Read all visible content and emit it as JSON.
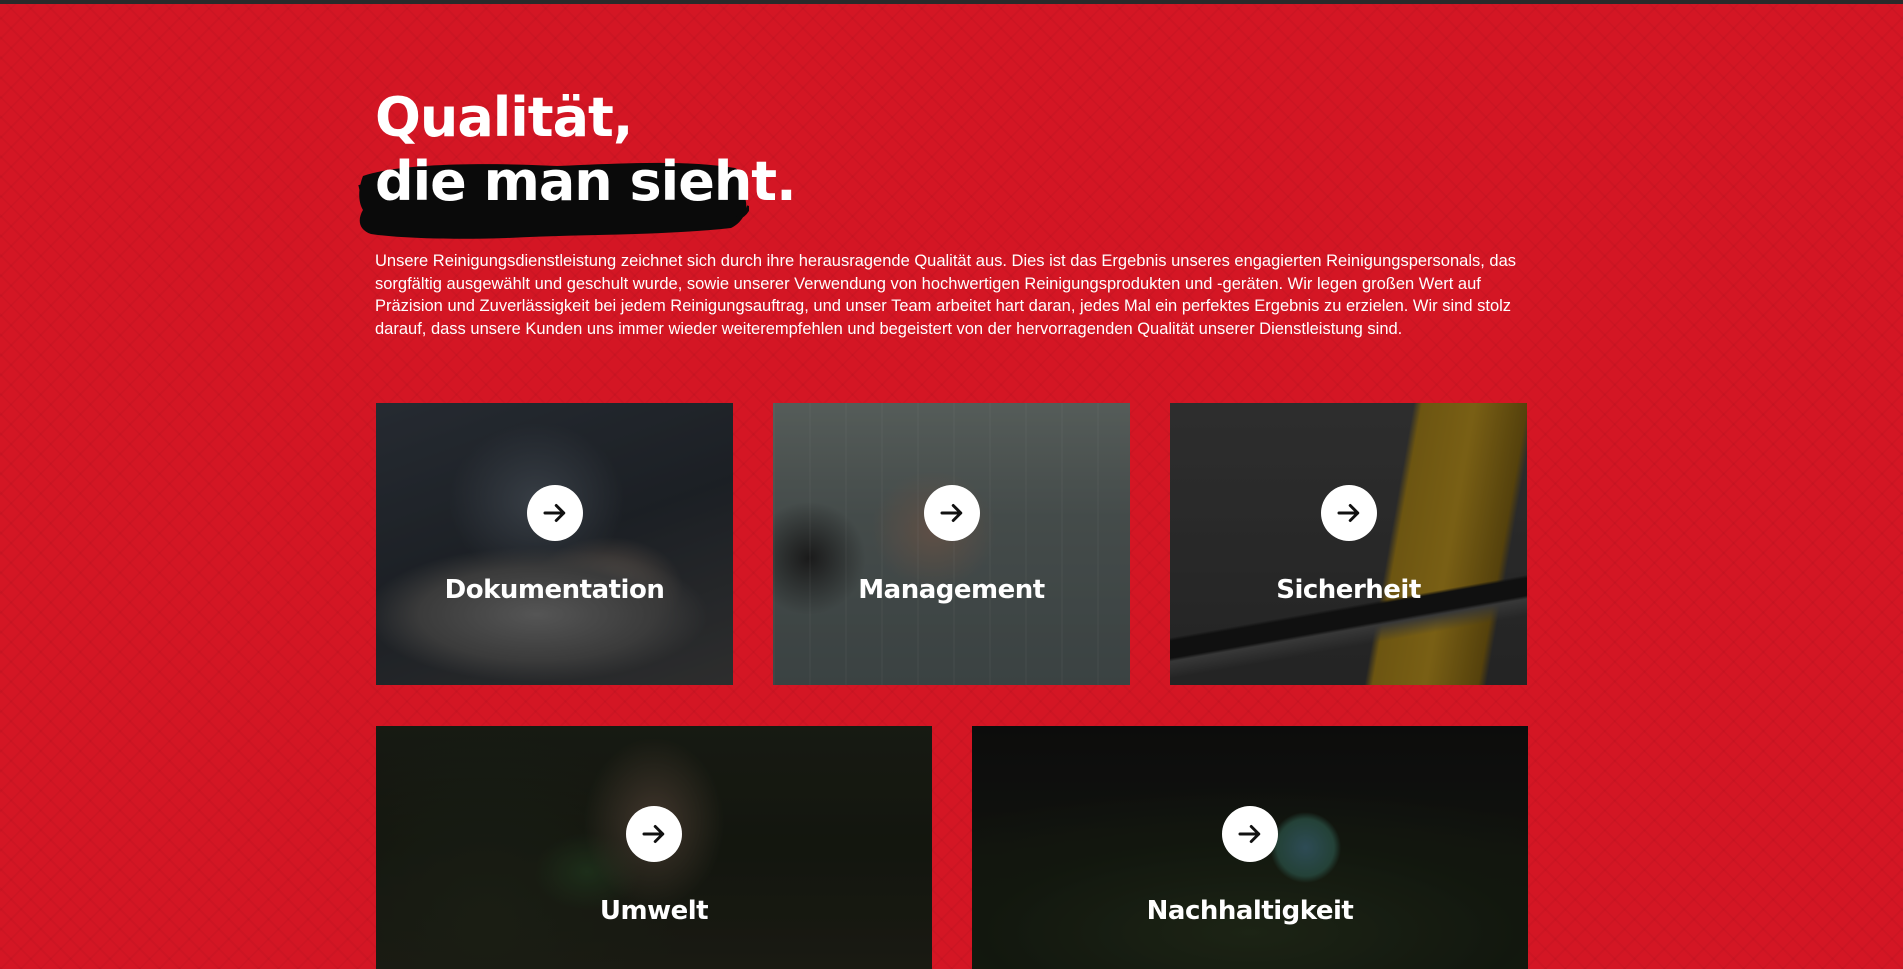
{
  "heading": {
    "line1": "Qualität,",
    "line2": "die man sieht."
  },
  "intro_text": "Unsere Reinigungsdienstleistung zeichnet sich durch ihre herausragende Qualität aus. Dies ist das Ergebnis unseres engagierten Reinigungsperso­nals, das sorgfältig ausgewählt und geschult wurde, sowie unserer Verwendung von hochwertigen Reinigungsprodukten und -geräten. Wir legen gro­ßen Wert auf Präzision und Zuverlässigkeit bei jedem Reinigungsauftrag, und unser Team arbeitet hart daran, jedes Mal ein perfektes Ergebnis zu er­zielen. Wir sind stolz darauf, dass unsere Kunden uns immer wieder weiterempfehlen und begeistert von der hervorragenden Qualität unserer Dienst­leistung sind.",
  "cards": [
    {
      "title": "Dokumentation",
      "icon": "arrow-right-icon",
      "photo": "hand signing document"
    },
    {
      "title": "Management",
      "icon": "arrow-right-icon",
      "photo": "person at control panel board"
    },
    {
      "title": "Sicherheit",
      "icon": "arrow-right-icon",
      "photo": "yellow wet floor warning sign"
    },
    {
      "title": "Umwelt",
      "icon": "arrow-right-icon",
      "photo": "hands holding plant sprout"
    },
    {
      "title": "Nachhaltigkeit",
      "icon": "arrow-right-icon",
      "photo": "globe on grass"
    }
  ],
  "colors": {
    "background": "#d41624",
    "brush": "#0a0a0a",
    "text": "#ffffff"
  }
}
